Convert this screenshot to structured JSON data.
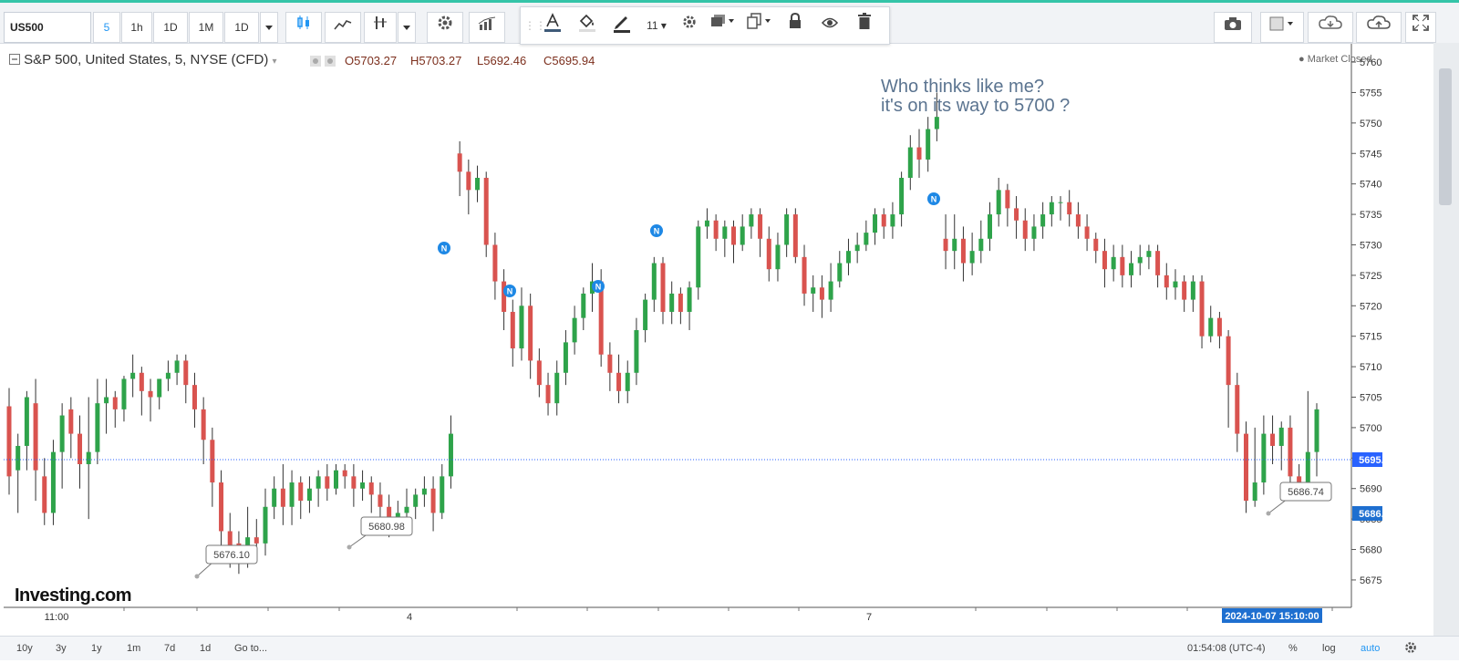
{
  "toolbar": {
    "symbol": "US500",
    "intervals": [
      "5",
      "1h",
      "1D",
      "1M",
      "1D"
    ],
    "active_interval": "5",
    "font_size": "11"
  },
  "legend": {
    "title": "S&P 500, United States, 5, NYSE (CFD)",
    "open": "O5703.27",
    "high": "H5703.27",
    "low": "L5692.46",
    "close": "C5695.94",
    "status": "Market Closed"
  },
  "annotation": {
    "line1": "Who thinks like me?",
    "line2": "it's on its way to 5700 ?"
  },
  "price_labels": {
    "current": "5695.94",
    "low_marker": "5686.74",
    "callout_1": "5676.10",
    "callout_2": "5680.98",
    "callout_3": "5686.74"
  },
  "logo": "Investing.com",
  "bottom": {
    "ranges": [
      "10y",
      "3y",
      "1y",
      "1m",
      "7d",
      "1d",
      "Go to..."
    ],
    "time": "01:54:08 (UTC-4)",
    "percent": "%",
    "log": "log",
    "auto": "auto",
    "crosshair_time": "2024-10-07 15:10:00"
  },
  "chart_data": {
    "type": "candlestick",
    "y_axis_ticks": [
      5760,
      5755,
      5750,
      5745,
      5740,
      5735,
      5730,
      5725,
      5720,
      5715,
      5710,
      5705,
      5700,
      5695,
      5690,
      5685,
      5680,
      5675
    ],
    "x_axis_labels": [
      "11:00",
      "4",
      "7"
    ],
    "ylim": [
      5670.5,
      5763
    ],
    "colors": {
      "up": "#2ea34a",
      "down": "#d9534f",
      "current_line": "#2962ff"
    }
  }
}
